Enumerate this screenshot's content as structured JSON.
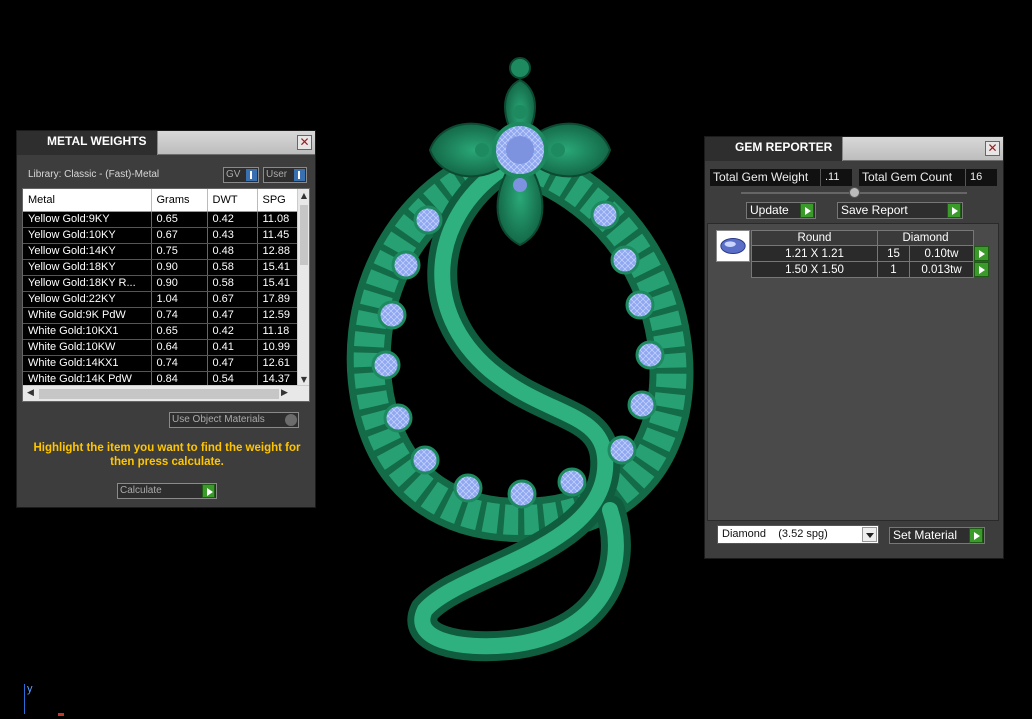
{
  "metal_weights": {
    "title": "METAL WEIGHTS",
    "library_label": "Library: Classic - (Fast)-Metal",
    "gv_label": "GV",
    "user_label": "User",
    "columns": [
      "Metal",
      "Grams",
      "DWT",
      "SPG"
    ],
    "rows": [
      {
        "metal": "Yellow Gold:9KY",
        "grams": "0.65",
        "dwt": "0.42",
        "spg": "11.08"
      },
      {
        "metal": "Yellow Gold:10KY",
        "grams": "0.67",
        "dwt": "0.43",
        "spg": "11.45"
      },
      {
        "metal": "Yellow Gold:14KY",
        "grams": "0.75",
        "dwt": "0.48",
        "spg": "12.88"
      },
      {
        "metal": "Yellow Gold:18KY",
        "grams": "0.90",
        "dwt": "0.58",
        "spg": "15.41"
      },
      {
        "metal": "Yellow Gold:18KY R...",
        "grams": "0.90",
        "dwt": "0.58",
        "spg": "15.41"
      },
      {
        "metal": "Yellow Gold:22KY",
        "grams": "1.04",
        "dwt": "0.67",
        "spg": "17.89"
      },
      {
        "metal": "White Gold:9K PdW",
        "grams": "0.74",
        "dwt": "0.47",
        "spg": "12.59"
      },
      {
        "metal": "White Gold:10KX1",
        "grams": "0.65",
        "dwt": "0.42",
        "spg": "11.18"
      },
      {
        "metal": "White Gold:10KW",
        "grams": "0.64",
        "dwt": "0.41",
        "spg": "10.99"
      },
      {
        "metal": "White Gold:14KX1",
        "grams": "0.74",
        "dwt": "0.47",
        "spg": "12.61"
      },
      {
        "metal": "White Gold:14K PdW",
        "grams": "0.84",
        "dwt": "0.54",
        "spg": "14.37"
      }
    ],
    "use_object_materials_label": "Use Object Materials",
    "hint": "Highlight the item you want to find the weight for then press calculate.",
    "calculate_label": "Calculate"
  },
  "gem_reporter": {
    "title": "GEM REPORTER",
    "total_weight_label": "Total Gem Weight",
    "total_weight_value": ".11",
    "total_count_label": "Total Gem Count",
    "total_count_value": "16",
    "update_label": "Update",
    "save_report_label": "Save Report",
    "columns": [
      "Round",
      "Diamond"
    ],
    "rows": [
      {
        "size": "1.21 X 1.21",
        "count": "15",
        "weight": "0.10tw"
      },
      {
        "size": "1.50 X 1.50",
        "count": "1",
        "weight": "0.013tw"
      }
    ],
    "material_selected": "Diamond    (3.52 spg)",
    "set_material_label": "Set Material"
  },
  "viewport": {
    "axis_label": "y"
  },
  "colors": {
    "model_green": "#1e9a6a",
    "gem_blue": "#9fb3f0",
    "hint_yellow": "#ffc600",
    "accent_green": "#3a9a2a"
  }
}
